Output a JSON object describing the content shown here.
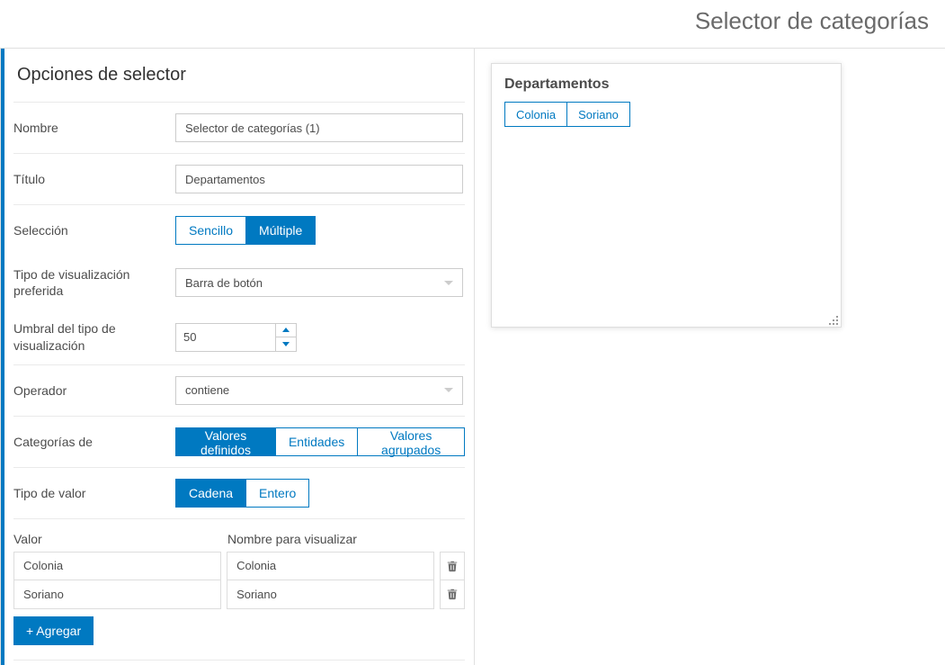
{
  "pageTitle": "Selector de categorías",
  "panel": {
    "heading": "Opciones de selector",
    "fields": {
      "nombre": {
        "label": "Nombre",
        "value": "Selector de categorías (1)"
      },
      "titulo": {
        "label": "Título",
        "value": "Departamentos"
      },
      "seleccion": {
        "label": "Selección",
        "options": [
          "Sencillo",
          "Múltiple"
        ],
        "active": 1
      },
      "vistype": {
        "label": "Tipo de visualización preferida",
        "value": "Barra de botón"
      },
      "umbral": {
        "label": "Umbral del tipo de visualización",
        "value": "50"
      },
      "operador": {
        "label": "Operador",
        "value": "contiene"
      },
      "categorias": {
        "label": "Categorías de",
        "options": [
          "Valores definidos",
          "Entidades",
          "Valores agrupados"
        ],
        "active": 0
      },
      "tipovalor": {
        "label": "Tipo de valor",
        "options": [
          "Cadena",
          "Entero"
        ],
        "active": 0
      }
    },
    "valuesTable": {
      "colValue": "Valor",
      "colDisplay": "Nombre para visualizar",
      "rows": [
        {
          "value": "Colonia",
          "display": "Colonia"
        },
        {
          "value": "Soriano",
          "display": "Soriano"
        }
      ],
      "addLabel": "+ Agregar"
    }
  },
  "preview": {
    "title": "Departamentos",
    "chips": [
      "Colonia",
      "Soriano"
    ]
  },
  "colors": {
    "accent": "#0079c1"
  }
}
